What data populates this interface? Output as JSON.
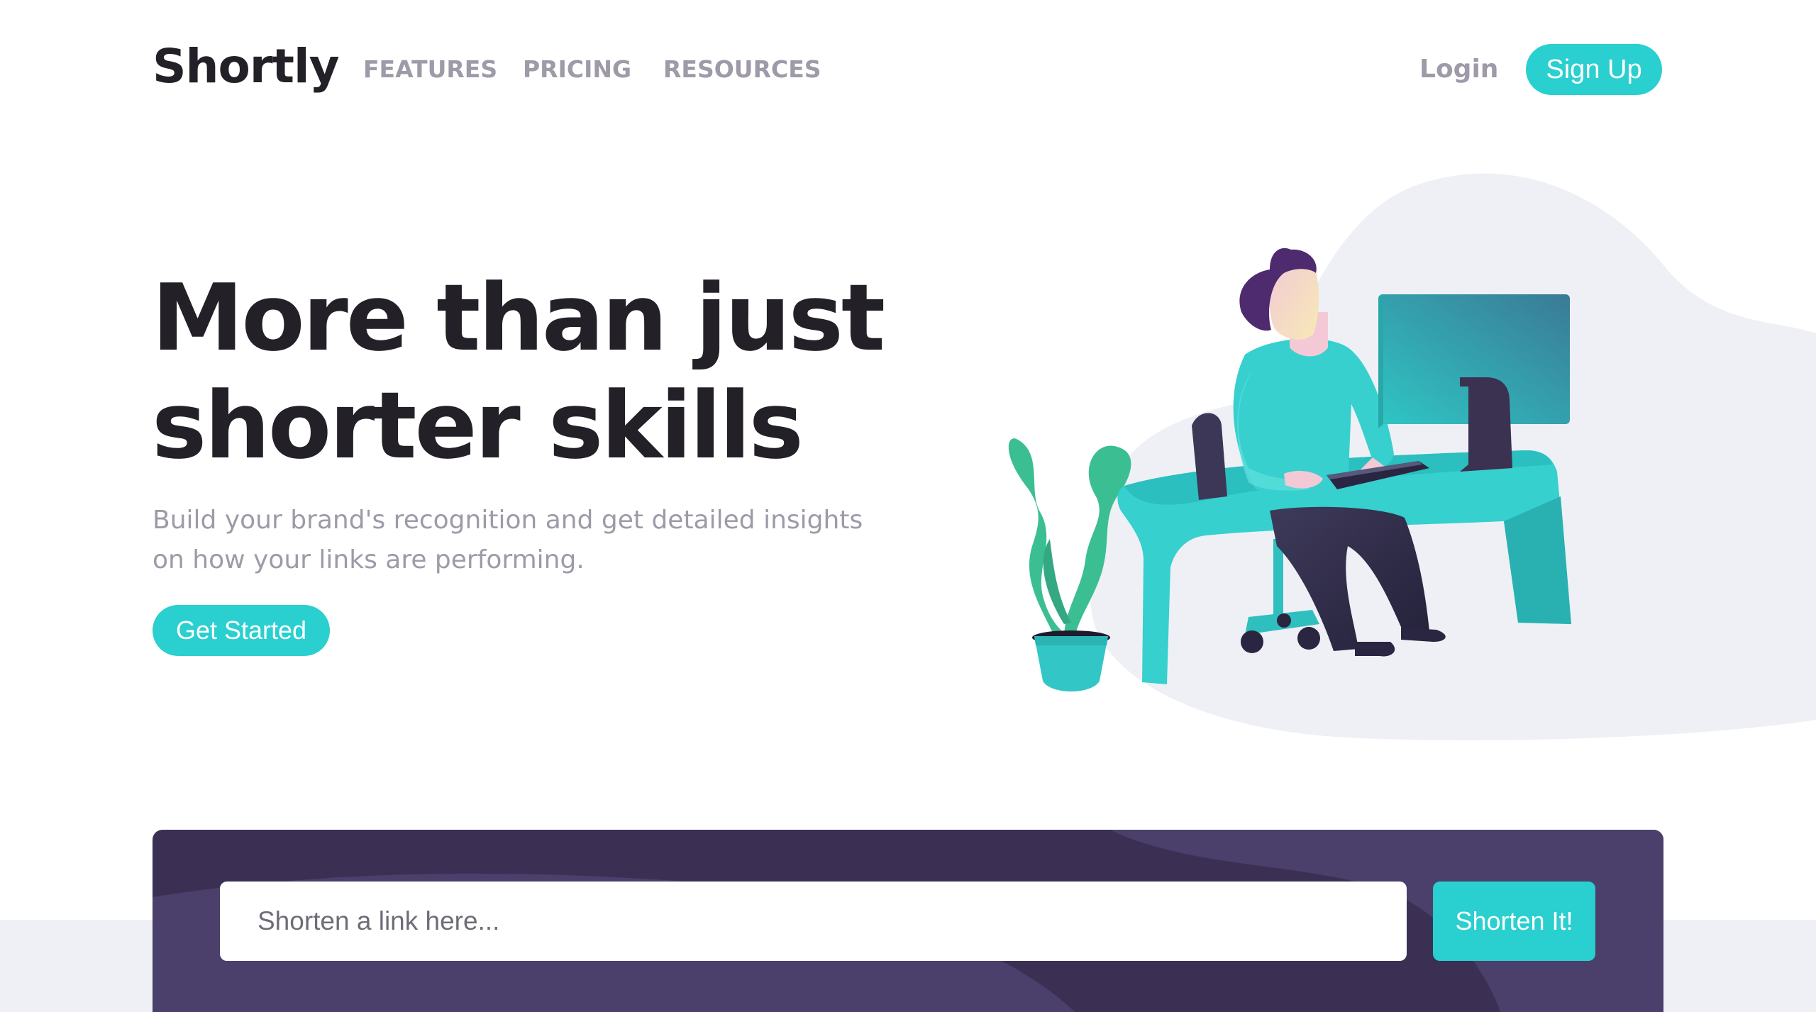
{
  "header": {
    "logo": "Shortly",
    "nav": [
      "FEATURES",
      "PRICING",
      "RESOURCES"
    ],
    "login_label": "Login",
    "signup_label": "Sign Up"
  },
  "hero": {
    "title_line1": "More than just",
    "title_line2": "shorter skills",
    "subtitle_line1": "Build your brand's recognition and get detailed insights",
    "subtitle_line2": "on how your links are performing.",
    "cta_label": "Get Started",
    "illustration_icon": "person-working-at-desk-illustration"
  },
  "shorten": {
    "placeholder": "Shorten a link here...",
    "button_label": "Shorten It!"
  },
  "colors": {
    "primary_cyan": "#2acfcf",
    "dark_violet": "#3b3054",
    "very_dark_violet": "#232127",
    "grayish_violet": "#9e9aa8",
    "light_gray_band": "#eff0f5"
  }
}
